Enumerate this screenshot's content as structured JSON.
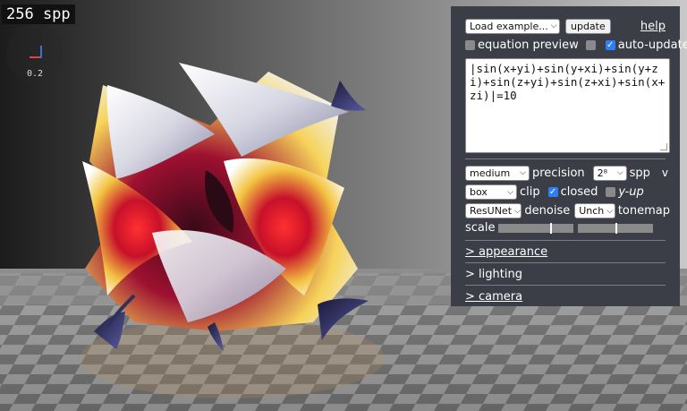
{
  "viewport": {
    "spp_counter": "256 spp",
    "axis_scale_label": "0.2"
  },
  "toolbar": {
    "example_select": "Load example...",
    "update_button": "update",
    "help_link": "help"
  },
  "options": {
    "equation_preview_label": "equation preview",
    "equation_preview_checked": false,
    "extra_checkbox_checked": false,
    "auto_update_label": "auto-update",
    "auto_update_checked": true
  },
  "equation": {
    "text": "|sin(x+yi)+sin(y+xi)+sin(y+zi)+sin(z+yi)+sin(z+xi)+sin(x+zi)|=10"
  },
  "render_settings": {
    "precision_select": "medium",
    "precision_label": "precision",
    "spp_select": "2⁸",
    "spp_label": "spp",
    "collapse_toggle": "v",
    "clip_select": "box",
    "clip_label": "clip",
    "closed_label": "closed",
    "closed_checked": true,
    "y_up_label": "y-up",
    "y_up_checked": false,
    "denoise_select": "ResUNet",
    "denoise_label": "denoise",
    "tonemap_select": "Unch",
    "tonemap_label": "tonemap",
    "scale_label": "scale",
    "scale_slider_1_value": 0.7,
    "scale_slider_2_value": 0.5
  },
  "sections": {
    "appearance": "> appearance",
    "lighting": "> lighting",
    "camera": "> camera"
  }
}
